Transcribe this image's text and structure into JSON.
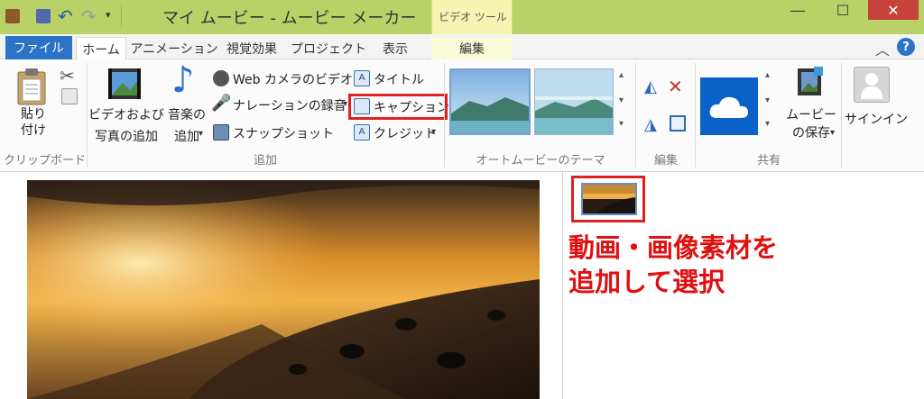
{
  "window": {
    "title": "マイ ムービー - ムービー メーカー",
    "context_tab_group": "ビデオ ツール",
    "minimize": "―",
    "maximize": "☐",
    "close": "✕"
  },
  "quick_access": {
    "icons": [
      "app-icon",
      "save-icon",
      "undo-icon",
      "redo-icon",
      "customize-dropdown-icon"
    ]
  },
  "tabs": [
    "ファイル",
    "ホーム",
    "アニメーション",
    "視覚効果",
    "プロジェクト",
    "表示",
    "編集"
  ],
  "ribbon": {
    "clipboard": {
      "paste_line1": "貼り",
      "paste_line2": "付け",
      "group_label": "クリップボード"
    },
    "add": {
      "add_video_line1": "ビデオおよび",
      "add_video_line2": "写真の追加",
      "add_music_line1": "音楽の",
      "add_music_line2": "追加",
      "webcam": "Web カメラのビデオ",
      "narration": "ナレーションの録音",
      "snapshot": "スナップショット",
      "title": "タイトル",
      "caption": "キャプション",
      "credits": "クレジット",
      "group_label": "追加"
    },
    "automovie": {
      "group_label": "オートムービーのテーマ"
    },
    "edit": {
      "group_label": "編集"
    },
    "share": {
      "save_movie_line1": "ムービー",
      "save_movie_line2": "の保存",
      "group_label": "共有"
    },
    "signin": "サインイン"
  },
  "annotation": {
    "line1": "動画・画像素材を",
    "line2": "追加して選択"
  },
  "colors": {
    "titlebar": "#b9d267",
    "file_tab": "#2b73c7",
    "highlight": "#e02020"
  }
}
